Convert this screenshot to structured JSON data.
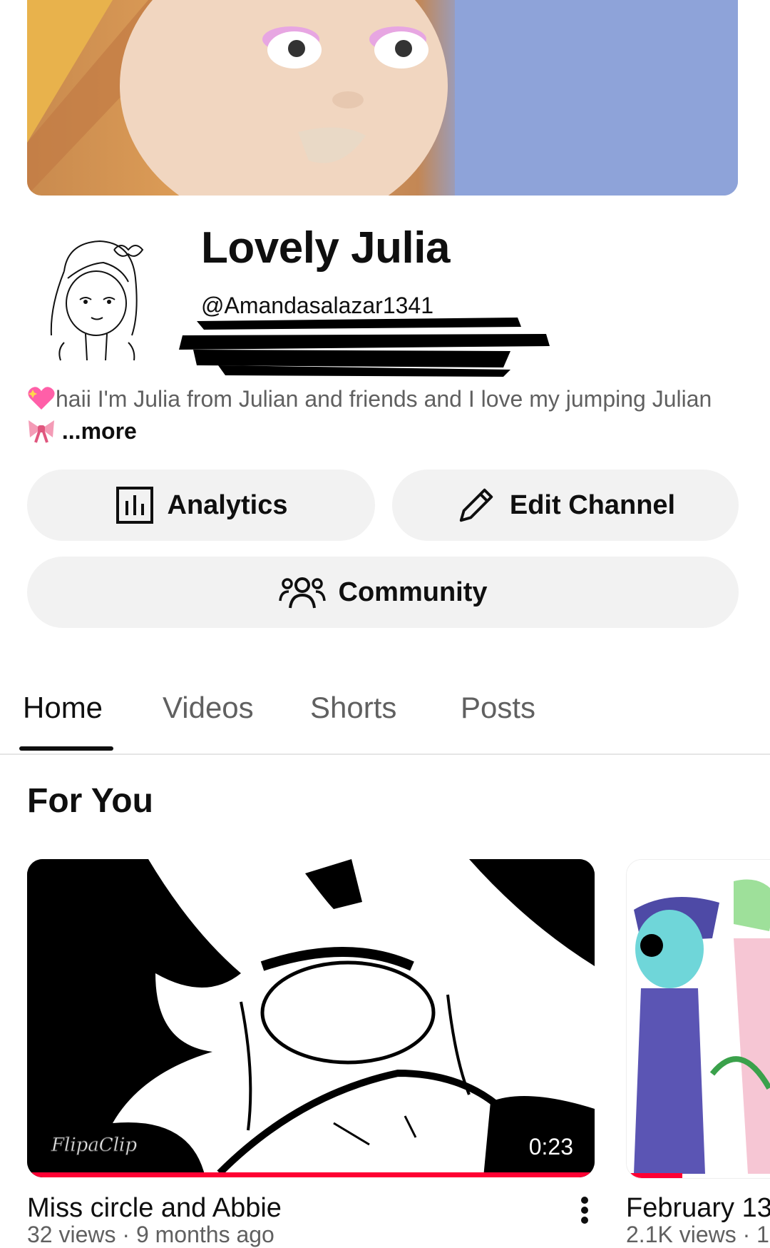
{
  "channel": {
    "name": "Lovely Julia",
    "handle": "@Amandasalazar1341",
    "description": "haii I'm Julia from Julian and friends and I love my jumping Julian",
    "more_label": "...more"
  },
  "actions": {
    "analytics_label": "Analytics",
    "edit_channel_label": "Edit Channel",
    "community_label": "Community"
  },
  "tabs": [
    {
      "label": "Home",
      "active": true
    },
    {
      "label": "Videos",
      "active": false
    },
    {
      "label": "Shorts",
      "active": false
    },
    {
      "label": "Posts",
      "active": false
    }
  ],
  "section": {
    "title": "For You"
  },
  "videos": [
    {
      "title": "Miss circle and Abbie",
      "meta": "32 views · 9 months ago",
      "duration": "0:23",
      "watermark": "FlipaClip",
      "watch_progress": 1.0
    },
    {
      "title": "February 13",
      "meta": "2.1K views · 1",
      "watch_progress": 0.35
    }
  ],
  "icons": {
    "analytics": "analytics-icon",
    "edit": "pencil-icon",
    "community": "community-icon",
    "more": "more-vertical-icon"
  },
  "colors": {
    "accent_red": "#ff0033",
    "button_bg": "#f2f2f2",
    "secondary_text": "#606060"
  }
}
